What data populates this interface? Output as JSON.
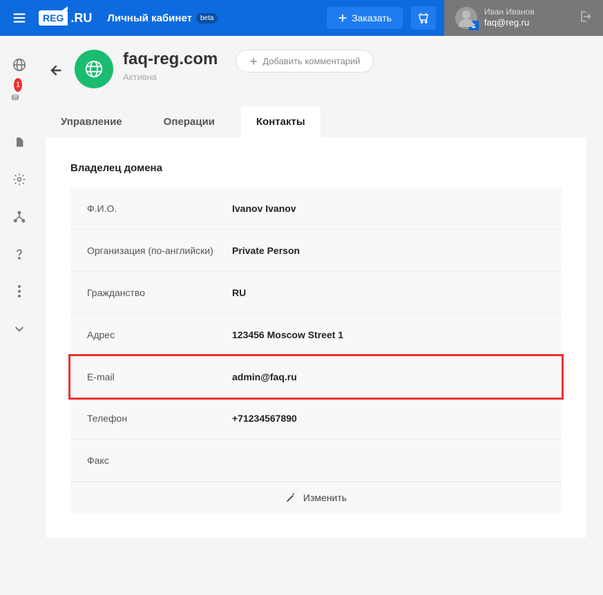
{
  "header": {
    "logo_left": "REG",
    "logo_right": ".RU",
    "cabinet": "Личный кабинет",
    "beta": "beta",
    "order": "Заказать",
    "user_name": "Иван Иванов",
    "user_email": "faq@reg.ru"
  },
  "rail": {
    "badge": "1"
  },
  "domain": {
    "title": "faq-reg.com",
    "status": "Активна",
    "add_comment": "Добавить комментарий"
  },
  "tabs": {
    "manage": "Управление",
    "ops": "Операции",
    "contacts": "Контакты"
  },
  "section": {
    "title": "Владелец домена",
    "edit": "Изменить",
    "rows": {
      "fio_label": "Ф.И.О.",
      "fio_value": "Ivanov Ivanov",
      "org_label": "Организация (по-английски)",
      "org_value": "Private Person",
      "cit_label": "Гражданство",
      "cit_value": "RU",
      "addr_label": "Адрес",
      "addr_value": "123456 Moscow Street 1",
      "email_label": "E-mail",
      "email_value": "admin@faq.ru",
      "phone_label": "Телефон",
      "phone_value": "+71234567890",
      "fax_label": "Факс",
      "fax_value": ""
    }
  }
}
